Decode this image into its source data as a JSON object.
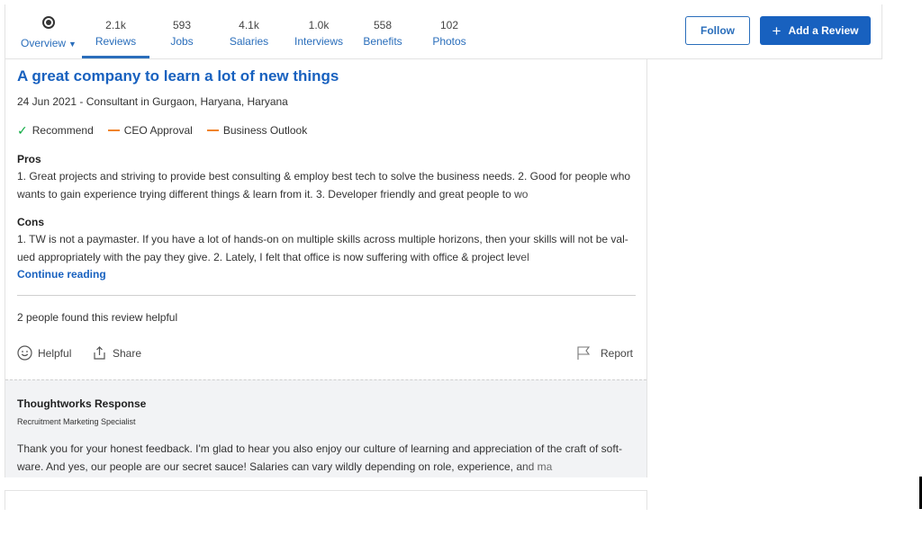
{
  "nav": {
    "tabs": [
      {
        "count": "",
        "label": "Overview"
      },
      {
        "count": "2.1k",
        "label": "Reviews"
      },
      {
        "count": "593",
        "label": "Jobs"
      },
      {
        "count": "4.1k",
        "label": "Salaries"
      },
      {
        "count": "1.0k",
        "label": "Interviews"
      },
      {
        "count": "558",
        "label": "Benefits"
      },
      {
        "count": "102",
        "label": "Photos"
      }
    ],
    "active_tab": "Reviews",
    "follow_label": "Follow",
    "add_review_label": "Add a Review"
  },
  "review": {
    "title": "A great company to learn a lot of new things",
    "meta": "24 Jun 2021 - Consultant in Gurgaon, Haryana, Haryana",
    "ratings": [
      "Recommend",
      "CEO Approval",
      "Business Outlook"
    ],
    "pros_heading": "Pros",
    "pros_text": "1. Great projects and striving to provide best consulting & employ best tech to solve the business needs. 2. Good for people who wants to gain experience trying different things & learn from it. 3. Developer friendly and great people to wo",
    "cons_heading": "Cons",
    "cons_text": "1. TW is not a paymaster. If you have a lot of hands-on on multiple skills across multiple horizons, then your skills will not be val- ued appropriately with the pay they give. 2. Lately, I felt that office is now suffering with office & project level",
    "continue_label": "Continue reading",
    "helpful_count": "2 people found this review helpful",
    "helpful_label": "Helpful",
    "share_label": "Share",
    "report_label": "Report"
  },
  "response": {
    "heading": "Thoughtworks Response",
    "role": "Recruitment Marketing Specialist",
    "text": "Thank you for your honest feedback. I'm glad to hear you also enjoy our culture of learning and appreciation of the craft of soft- ware. And yes, our people are our secret sauce! Salaries can vary wildly depending on role, experience, and ma"
  },
  "colors": {
    "link": "#1861bf",
    "recommend": "#0caa41",
    "neutral": "#f0842c"
  },
  "icons": {
    "overview": "overview-target-icon",
    "chevron": "chevron-down-icon",
    "add": "plus-icon",
    "recommend": "check-icon",
    "ceo": "dash-icon",
    "outlook": "dash-icon",
    "helpful": "smiley-icon",
    "share": "share-icon",
    "report": "flag-icon"
  }
}
